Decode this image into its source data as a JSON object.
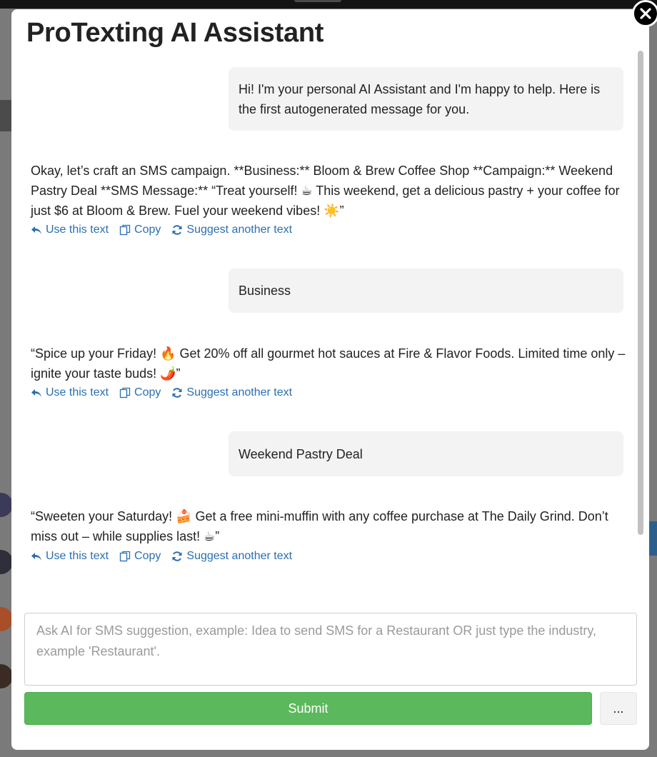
{
  "modal": {
    "title": "ProTexting AI Assistant"
  },
  "messages": [
    {
      "role": "user",
      "text": "Hi! I'm your personal AI Assistant and I'm happy to help. Here is the first autogenerated message for you."
    },
    {
      "role": "assistant",
      "text": "Okay, let’s craft an SMS campaign. **Business:** Bloom & Brew Coffee Shop **Campaign:** Weekend Pastry Deal **SMS Message:** “Treat yourself! ☕ This weekend, get a delicious pastry + your coffee for just $6 at Bloom & Brew. Fuel your weekend vibes! ☀️”"
    },
    {
      "role": "user",
      "text": "Business"
    },
    {
      "role": "assistant",
      "text": "“Spice up your Friday! 🔥 Get 20% off all gourmet hot sauces at Fire & Flavor Foods. Limited time only – ignite your taste buds! 🌶️”"
    },
    {
      "role": "user",
      "text": "Weekend Pastry Deal"
    },
    {
      "role": "assistant",
      "text": "“Sweeten your Saturday! 🍰 Get a free mini-muffin with any coffee purchase at The Daily Grind. Don’t miss out – while supplies last! ☕”"
    }
  ],
  "actions": {
    "use": "Use this text",
    "copy": "Copy",
    "suggest": "Suggest another text"
  },
  "input": {
    "value": "",
    "placeholder": "Ask AI for SMS suggestion, example: Idea to send SMS for a Restaurant OR just type the industry, example 'Restaurant'."
  },
  "buttons": {
    "submit": "Submit",
    "more": "..."
  },
  "icons": {
    "close": "close-icon",
    "use": "reply-icon",
    "copy": "copy-icon",
    "suggest": "refresh-icon"
  },
  "colors": {
    "accent_link": "#2a6fb0",
    "submit_green": "#5cb85c",
    "bubble_bg": "#f3f3f3"
  }
}
